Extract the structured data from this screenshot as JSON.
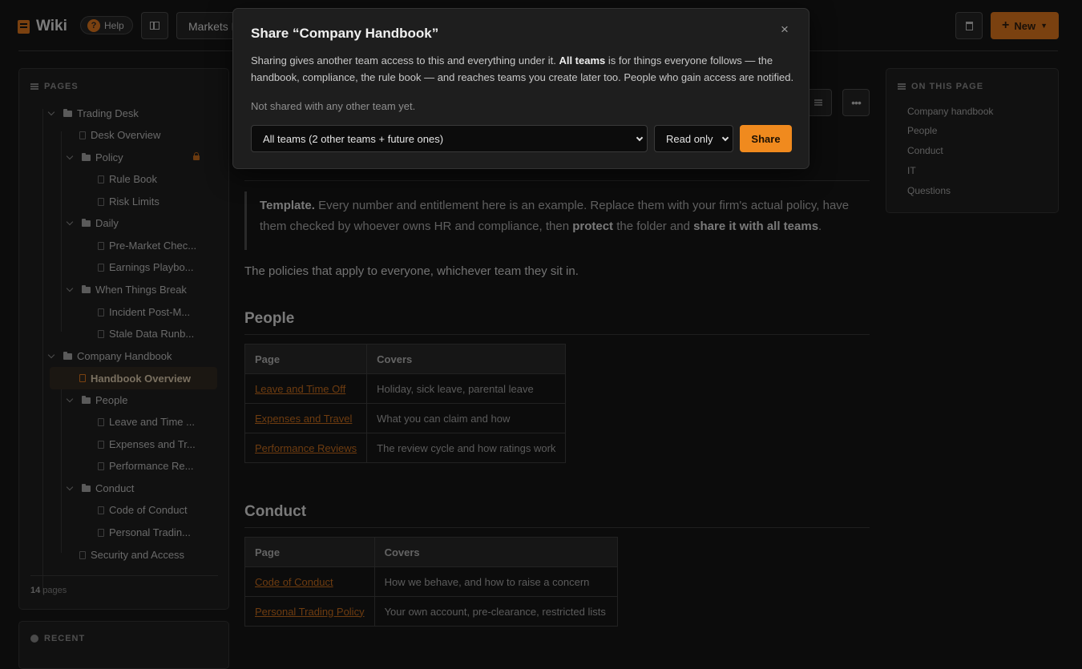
{
  "app": {
    "name": "Wiki",
    "help_label": "Help",
    "new_label": "New"
  },
  "breadcrumb": {
    "text": "Markets D"
  },
  "sidebar": {
    "title": "PAGES",
    "footer_count": "14",
    "footer_label": "pages",
    "recent_title": "RECENT",
    "items": [
      {
        "label": "Trading Desk",
        "type": "folder"
      },
      {
        "label": "Desk Overview",
        "type": "page"
      },
      {
        "label": "Policy",
        "type": "folder"
      },
      {
        "label": "Rule Book",
        "type": "page"
      },
      {
        "label": "Risk Limits",
        "type": "page"
      },
      {
        "label": "Daily",
        "type": "folder"
      },
      {
        "label": "Pre-Market Chec...",
        "type": "page"
      },
      {
        "label": "Earnings Playbo...",
        "type": "page"
      },
      {
        "label": "When Things Break",
        "type": "folder"
      },
      {
        "label": "Incident Post-M...",
        "type": "page"
      },
      {
        "label": "Stale Data Runb...",
        "type": "page"
      },
      {
        "label": "Company Handbook",
        "type": "folder"
      },
      {
        "label": "Handbook Overview",
        "type": "page"
      },
      {
        "label": "People",
        "type": "folder"
      },
      {
        "label": "Leave and Time ...",
        "type": "page"
      },
      {
        "label": "Expenses and Tr...",
        "type": "page"
      },
      {
        "label": "Performance Re...",
        "type": "page"
      },
      {
        "label": "Conduct",
        "type": "folder"
      },
      {
        "label": "Code of Conduct",
        "type": "page"
      },
      {
        "label": "Personal Tradin...",
        "type": "page"
      },
      {
        "label": "Security and Access",
        "type": "page"
      }
    ]
  },
  "main": {
    "note_label": "Template.",
    "note_text_1": "Every number and entitlement here is an example. Replace them with your firm's actual policy, have them checked by whoever owns HR and compliance, then",
    "note_bold_protect": "protect",
    "note_text_2": "the folder and",
    "note_bold_share": "share it with all teams",
    "note_end": ".",
    "intro": "The policies that apply to everyone, whichever team they sit in.",
    "people_heading": "People",
    "conduct_heading": "Conduct",
    "table_headers": [
      "Page",
      "Covers"
    ],
    "people_rows": [
      [
        "Leave and Time Off",
        "Holiday, sick leave, parental leave"
      ],
      [
        "Expenses and Travel",
        "What you can claim and how"
      ],
      [
        "Performance Reviews",
        "The review cycle and how ratings work"
      ]
    ],
    "conduct_rows": [
      [
        "Code of Conduct",
        "How we behave, and how to raise a concern"
      ],
      [
        "Personal Trading Policy",
        "Your own account, pre-clearance, restricted lists"
      ]
    ]
  },
  "toc": {
    "title": "ON THIS PAGE",
    "items": [
      "Company handbook",
      "People",
      "Conduct",
      "IT",
      "Questions"
    ]
  },
  "modal": {
    "title": "Share “Company Handbook”",
    "desc_1": "Sharing gives another team access to this and everything under it.",
    "desc_bold": "All teams",
    "desc_2": "is for things everyone follows — the handbook, compliance, the rule book — and reaches teams you create later too. People who gain access are notified.",
    "status": "Not shared with any other team yet.",
    "team_select": "All teams (2 other teams + future ones)",
    "access_select": "Read only",
    "share_label": "Share",
    "close_glyph": "×"
  },
  "colors": {
    "accent": "#f08a1e",
    "dim_accent": "#7a4110"
  }
}
